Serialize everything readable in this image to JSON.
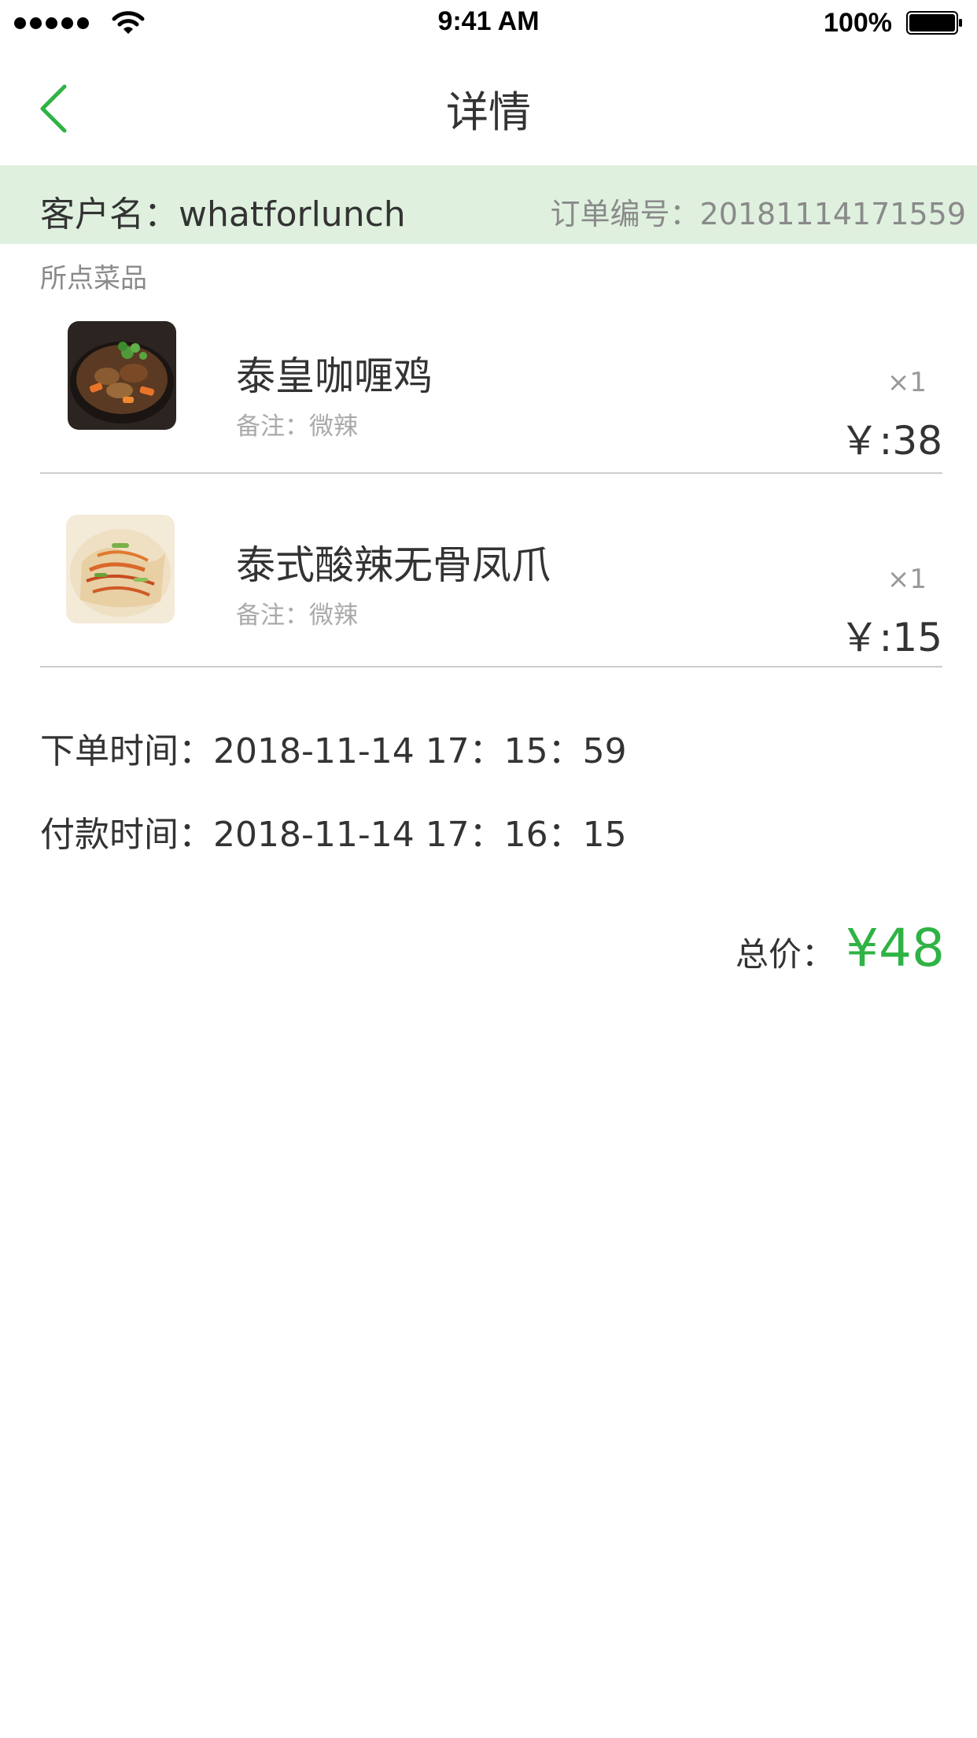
{
  "status_bar": {
    "time": "9:41 AM",
    "battery": "100%"
  },
  "nav": {
    "title": "详情",
    "back_icon": "chevron-left-icon"
  },
  "order": {
    "customer": "客户名：whatforlunch",
    "order_no": "订单编号：20181114171559"
  },
  "dishes_label": "所点菜品",
  "dishes": [
    {
      "name": "泰皇咖喱鸡",
      "note": "备注：微辣",
      "qty": "×1",
      "price": "￥:38"
    },
    {
      "name": "泰式酸辣无骨凤爪",
      "note": "备注：微辣",
      "qty": "×1",
      "price": "￥:15"
    }
  ],
  "times": {
    "order_time": "下单时间：2018-11-14 17：15：59",
    "pay_time": "付款时间：2018-11-14 17：16：15"
  },
  "total": {
    "label": "总价：",
    "value": "¥48"
  },
  "colors": {
    "accent": "#2fb344",
    "band": "#dff0df"
  }
}
